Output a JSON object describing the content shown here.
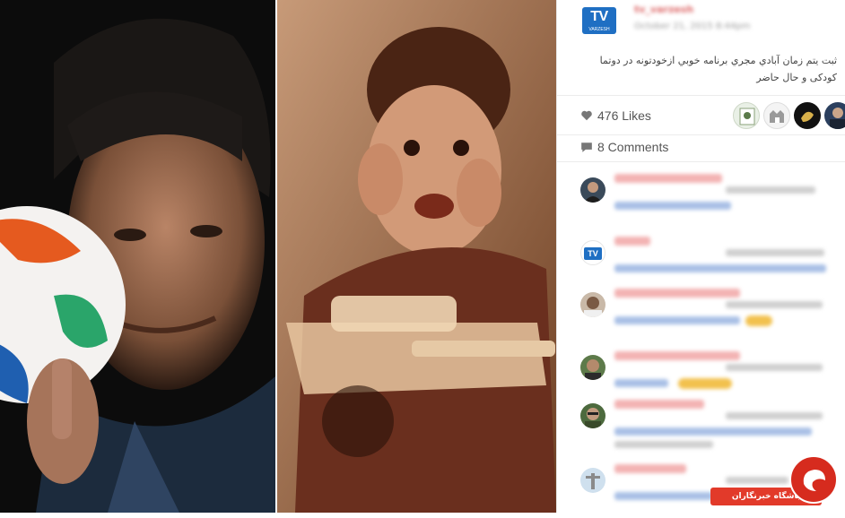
{
  "post": {
    "username": "tv_varzesh",
    "date": "October 21, 2015 8:44pm",
    "logo": {
      "main": "TV",
      "sub": "VARZESH"
    },
    "caption": "ثبت یتم زمان آبادي مجري برنامه خوبي ازخودتونه در دوتما کودکی و حال حاضر"
  },
  "likes": {
    "label": "476 Likes"
  },
  "comments": {
    "label": "8 Comments"
  },
  "comment_items": [
    {
      "avatar": "avatar-man-suit"
    },
    {
      "avatar": "avatar-tv-logo",
      "logo": "TV"
    },
    {
      "avatar": "avatar-man"
    },
    {
      "avatar": "avatar-man-outdoor"
    },
    {
      "avatar": "avatar-man-glasses"
    },
    {
      "avatar": "avatar-statue"
    }
  ],
  "badge": {
    "text": "باشگاه خبرنگاران"
  },
  "colors": {
    "link": "#a9c0e6",
    "username": "#f3b3b3",
    "logo": "#1f6fc3",
    "badge": "#e23a2a"
  }
}
